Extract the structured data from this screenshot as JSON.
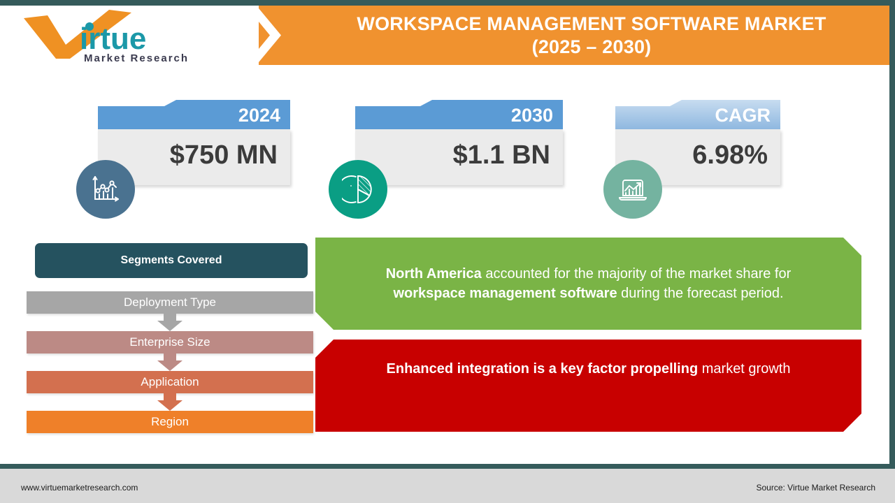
{
  "colors": {
    "frame": "#355b5b",
    "banner_orange": "#f0922f",
    "card_header_blue": "#5b9bd5",
    "card_header_light": "#9dc3e6",
    "card_body_gray": "#ebebeb",
    "icon_circle_1": "#4a7290",
    "icon_circle_2": "#0a9e84",
    "icon_circle_3": "#74b3a0",
    "segments_header": "#25525f",
    "callout_green": "#7ab446",
    "callout_red": "#c80000",
    "footer_band": "#d9d9d9"
  },
  "logo": {
    "brand": "Virtue",
    "tagline": "Market Research",
    "check_color": "#ef9123",
    "word_color": "#1b98a8",
    "tagline_color": "#3b3b4f"
  },
  "header": {
    "title_line1": "WORKSPACE MANAGEMENT SOFTWARE MARKET",
    "title_line2": "(2025 – 2030)",
    "chevron_icon": "chevron-right-icon"
  },
  "stats": [
    {
      "label": "2024",
      "value": "$750 MN",
      "icon": "line-chart-icon"
    },
    {
      "label": "2030",
      "value": "$1.1 BN",
      "icon": "pie-chart-icon"
    },
    {
      "label": "CAGR",
      "value": "6.98%",
      "icon": "growth-laptop-icon"
    }
  ],
  "segments": {
    "header": "Segments Covered",
    "items": [
      {
        "label": "Deployment Type",
        "color": "#a6a6a6"
      },
      {
        "label": "Enterprise Size",
        "color": "#bc8a85"
      },
      {
        "label": "Application",
        "color": "#d3704f"
      },
      {
        "label": "Region",
        "color": "#ef8029"
      }
    ],
    "arrow_colors": [
      "#a6a6a6",
      "#bc8a85",
      "#d3704f"
    ],
    "arrow_icon": "arrow-down-icon"
  },
  "callouts": {
    "green": {
      "part1_bold": "North America",
      "part2": " accounted for the majority of the market share for ",
      "part3_bold": "workspace management software",
      "part4": " during the forecast period."
    },
    "red": {
      "part1_bold": "Enhanced integration is a key factor propelling",
      "part2": " market growth"
    }
  },
  "footer": {
    "website": "www.virtuemarketresearch.com",
    "source": "Source: Virtue Market Research"
  }
}
